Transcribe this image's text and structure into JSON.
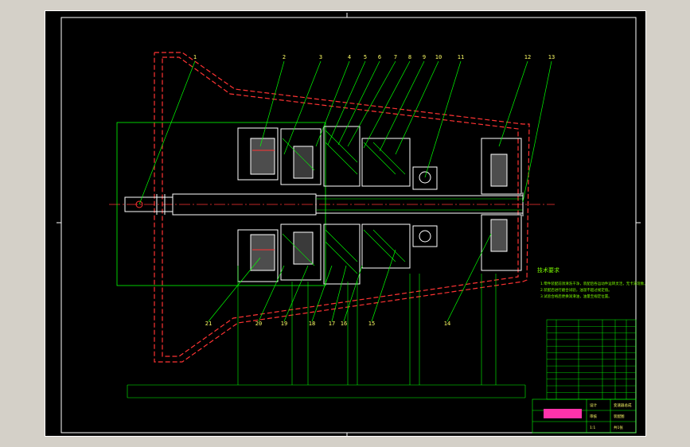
{
  "balloons": [
    {
      "n": "1"
    },
    {
      "n": "2"
    },
    {
      "n": "3"
    },
    {
      "n": "4"
    },
    {
      "n": "5"
    },
    {
      "n": "6"
    },
    {
      "n": "7"
    },
    {
      "n": "8"
    },
    {
      "n": "9"
    },
    {
      "n": "10"
    },
    {
      "n": "11"
    },
    {
      "n": "12"
    },
    {
      "n": "13"
    },
    {
      "n": "21"
    },
    {
      "n": "20"
    },
    {
      "n": "19"
    },
    {
      "n": "18"
    },
    {
      "n": "17"
    },
    {
      "n": "16"
    },
    {
      "n": "15"
    },
    {
      "n": "14"
    }
  ],
  "notes": {
    "title": "技术要求",
    "lines": [
      "1.零件装配前须清洗干净，装配后各运动件运转灵活，无卡滞现象。",
      "2.装配后进行磨合试验，油温不超过规定值。",
      "3.试验合格后更换润滑油，油量至规定位置。"
    ]
  },
  "title_block": {
    "part_name": "变速器总成",
    "drawing_no": "装配图",
    "designer": "设计",
    "checker": "审核",
    "scale": "1:1",
    "sheet": "共1张"
  },
  "colors": {
    "outline": "#ffffff",
    "section": "#00ff00",
    "hidden": "#ff3333",
    "leader": "#00ff00",
    "text": "#ffff66",
    "border": "#00ff00"
  }
}
